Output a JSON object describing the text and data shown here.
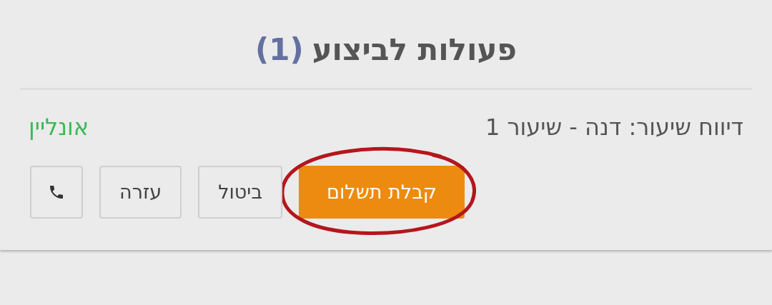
{
  "title": "פעולות לביצוע",
  "count": "(1)",
  "task": {
    "text": "דיווח שיעור: דנה - שיעור 1",
    "status": "אונליין"
  },
  "buttons": [
    {
      "kind": "primary",
      "label": "קבלת תשלום",
      "circled": true
    },
    {
      "kind": "outline",
      "label": "ביטול",
      "circled": false
    },
    {
      "kind": "outline",
      "label": "עזרה",
      "circled": false
    },
    {
      "kind": "phone",
      "circled": false
    }
  ]
}
